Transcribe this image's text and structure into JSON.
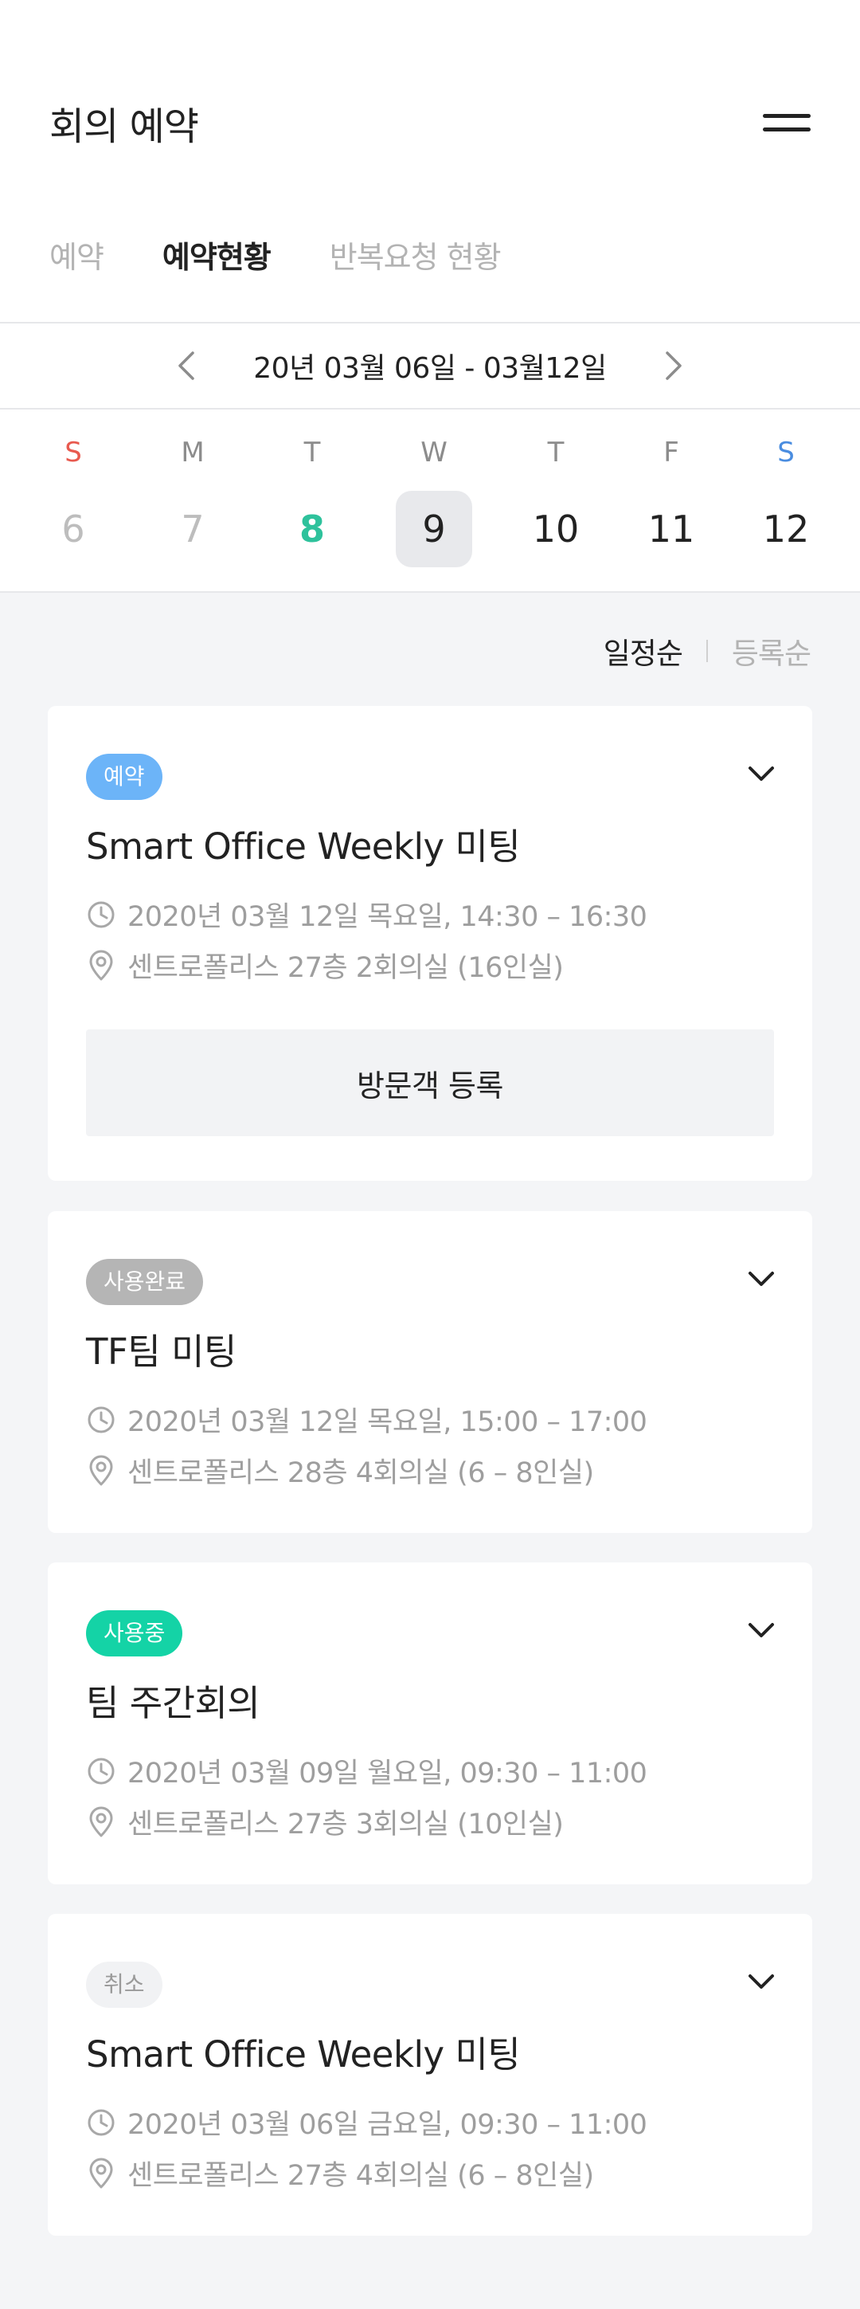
{
  "header": {
    "title": "회의 예약"
  },
  "tabs": [
    {
      "label": "예약"
    },
    {
      "label": "예약현황"
    },
    {
      "label": "반복요청 현황"
    }
  ],
  "date_range": {
    "label": "20년 03월 06일 - 03월12일"
  },
  "week": [
    {
      "dow": "S",
      "num": "6"
    },
    {
      "dow": "M",
      "num": "7"
    },
    {
      "dow": "T",
      "num": "8"
    },
    {
      "dow": "W",
      "num": "9"
    },
    {
      "dow": "T",
      "num": "10"
    },
    {
      "dow": "F",
      "num": "11"
    },
    {
      "dow": "S",
      "num": "12"
    }
  ],
  "sort": {
    "by_schedule": "일정순",
    "by_registration": "등록순"
  },
  "colors": {
    "reserve": "#6cb4f8",
    "done": "#b5b5b5",
    "inuse": "#14d3a6",
    "today": "#2ec29c",
    "sunday": "#e85a4f",
    "saturday": "#4a8de0"
  },
  "cards": [
    {
      "badge": "예약",
      "title": "Smart Office Weekly 미팅",
      "time": "2020년 03월 12일 목요일, 14:30 – 16:30",
      "location": "센트로폴리스 27층 2회의실 (16인실)",
      "button": "방문객 등록"
    },
    {
      "badge": "사용완료",
      "title": "TF팀 미팅",
      "time": "2020년 03월 12일 목요일, 15:00 – 17:00",
      "location": "센트로폴리스 28층 4회의실 (6 – 8인실)"
    },
    {
      "badge": "사용중",
      "title": "팀 주간회의",
      "time": "2020년 03월 09일 월요일, 09:30 – 11:00",
      "location": "센트로폴리스 27층 3회의실 (10인실)"
    },
    {
      "badge": "취소",
      "title": "Smart Office Weekly 미팅",
      "time": "2020년 03월 06일 금요일, 09:30 – 11:00",
      "location": "센트로폴리스 27층 4회의실 (6 – 8인실)"
    }
  ]
}
